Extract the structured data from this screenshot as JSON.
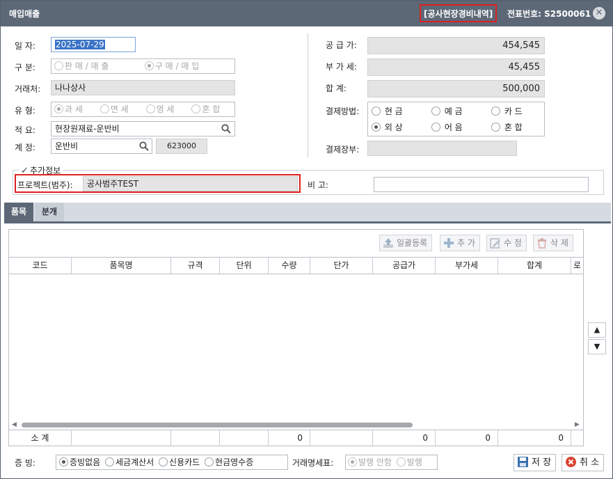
{
  "window": {
    "title": "매입매출",
    "tag": "[공사현장경비내역]",
    "doc_no": "전표번호: S2500061",
    "close_glyph": "✕"
  },
  "left_form": {
    "date_label": "일      자:",
    "date_value": "2025-07-29",
    "type_label": "구      분:",
    "type_options": [
      "판 매 / 매 출",
      "구 매 / 매 입"
    ],
    "type_selected": 1,
    "partner_label": "거래처:",
    "partner_value": "나나상사",
    "kind_label": "유      형:",
    "kind_options": [
      "과 세",
      "면 세",
      "영 세",
      "혼 합"
    ],
    "kind_selected": 0,
    "summary_label": "적      요:",
    "summary_value": "현장원재료-운반비",
    "account_label": "계      정:",
    "account_value": "운반비",
    "account_code": "623000"
  },
  "right_form": {
    "supply_label": "공 급 가:",
    "supply_value": "454,545",
    "vat_label": "부 가 세:",
    "vat_value": "45,455",
    "total_label": "합      계:",
    "total_value": "500,000",
    "payment_label": "결제방법:",
    "payment_options": [
      "현 금",
      "예 금",
      "카 드",
      "외 상",
      "어 음",
      "혼 합"
    ],
    "payment_selected": 3,
    "ledger_label": "결제장부:",
    "ledger_value": ""
  },
  "extra": {
    "legend": "추가정보",
    "checked": true,
    "project_label": "프로젝트(범주):",
    "project_value": "공사범주TEST",
    "memo_label": "비      고:",
    "memo_value": ""
  },
  "tabs": [
    "품목",
    "분개"
  ],
  "toolbar": {
    "bulk_label": "일괄등록",
    "add_label": "추 가",
    "edit_label": "수 정",
    "delete_label": "삭 제"
  },
  "grid": {
    "columns": [
      "코드",
      "품목명",
      "규격",
      "단위",
      "수량",
      "단가",
      "공급가",
      "부가세",
      "합계",
      "로"
    ],
    "footer_label": "소 계",
    "footer_values": {
      "qty": "0",
      "supply": "0",
      "vat": "0",
      "total": "0"
    }
  },
  "side": {
    "up": "▲",
    "down": "▼"
  },
  "bottom": {
    "evidence_label": "증 빙:",
    "evidence_options": [
      "증빙없음",
      "세금계산서",
      "신용카드",
      "현금영수증"
    ],
    "evidence_selected": 0,
    "statement_label": "거래명세표:",
    "statement_options": [
      "발행 안함",
      "발행"
    ],
    "statement_selected": 0,
    "save_label": "저 장",
    "cancel_label": "취 소"
  },
  "colors": {
    "titlebar": "#5d6877",
    "highlight": "#e02020",
    "selection": "#3a73c6"
  }
}
